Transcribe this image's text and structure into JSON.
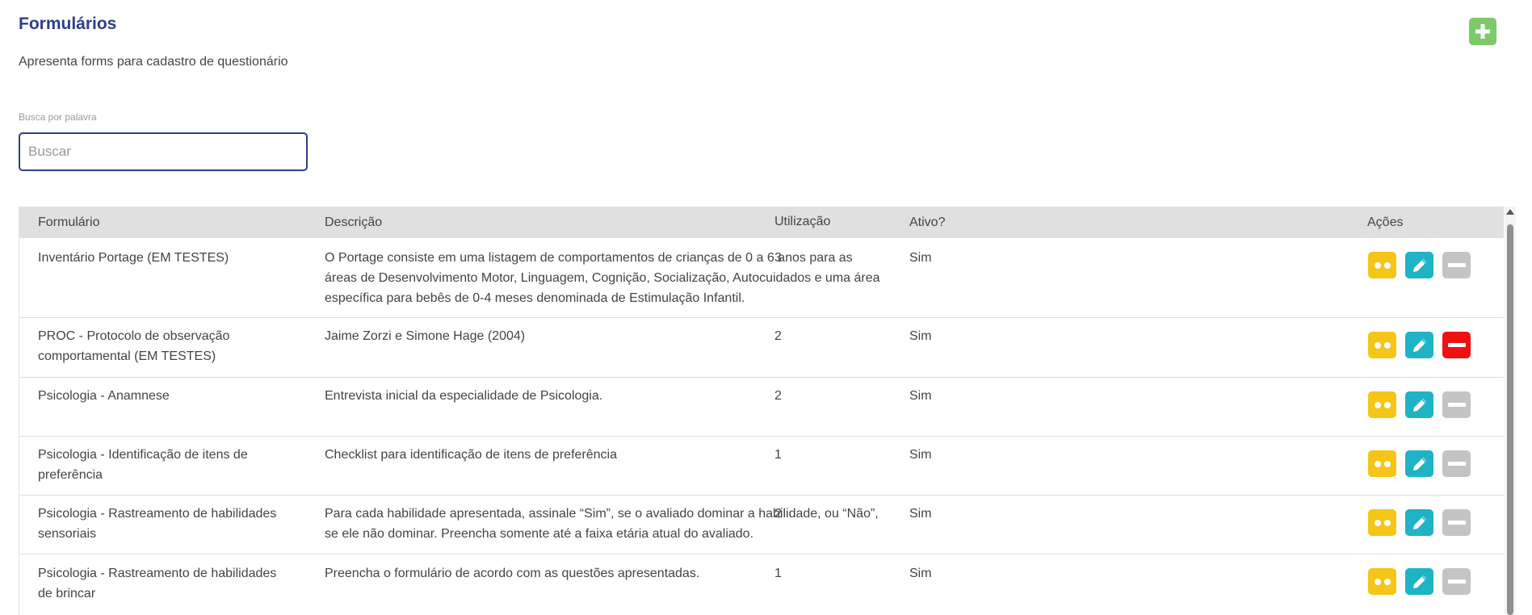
{
  "page": {
    "title": "Formulários",
    "subtitle": "Apresenta forms para cadastro de questionário"
  },
  "search": {
    "label": "Busca por palavra",
    "placeholder": "Buscar",
    "value": ""
  },
  "table": {
    "headers": {
      "form": "Formulário",
      "desc": "Descrição",
      "util": "Utilização",
      "ativo": "Ativo?",
      "acoes": "Ações"
    },
    "rows": [
      {
        "form": "Inventário Portage (EM TESTES)",
        "desc": "O Portage consiste em uma listagem de comportamentos de crianças de 0 a 6 anos para as áreas de Desenvolvimento Motor, Linguagem, Cognição, Socialização, Autocuidados e uma área específica para bebês de 0-4 meses denominada de Estimulação Infantil.",
        "util": "3",
        "ativo": "Sim",
        "delete_state": "disabled"
      },
      {
        "form": "PROC - Protocolo de observação comportamental (EM TESTES)",
        "desc": "Jaime Zorzi e Simone Hage (2004)",
        "util": "2",
        "ativo": "Sim",
        "delete_state": "active"
      },
      {
        "form": "Psicologia - Anamnese",
        "desc": "Entrevista inicial da especialidade de Psicologia.",
        "util": "2",
        "ativo": "Sim",
        "delete_state": "disabled"
      },
      {
        "form": "Psicologia - Identificação de itens de preferência",
        "desc": "Checklist para identificação de itens de preferência",
        "util": "1",
        "ativo": "Sim",
        "delete_state": "disabled"
      },
      {
        "form": "Psicologia - Rastreamento de habilidades sensoriais",
        "desc": "Para cada habilidade apresentada, assinale “Sim”, se o avaliado dominar a habilidade, ou “Não”, se ele não dominar. Preencha somente até a faixa etária atual do avaliado.",
        "util": "2",
        "ativo": "Sim",
        "delete_state": "disabled"
      },
      {
        "form": "Psicologia - Rastreamento de habilidades de brincar",
        "desc": "Preencha o formulário de acordo com as questões apresentadas.",
        "util": "1",
        "ativo": "Sim",
        "delete_state": "disabled"
      }
    ]
  },
  "colors": {
    "title": "#2c3e8c",
    "add_button": "#7ec96a",
    "view_button": "#f5c518",
    "edit_button": "#1fb3c5",
    "delete_disabled": "#c4c4c4",
    "delete_active": "#f01010"
  },
  "icons": {
    "add": "plus-icon",
    "view": "eye-dots-icon",
    "edit": "pencil-icon",
    "delete": "minus-icon"
  }
}
